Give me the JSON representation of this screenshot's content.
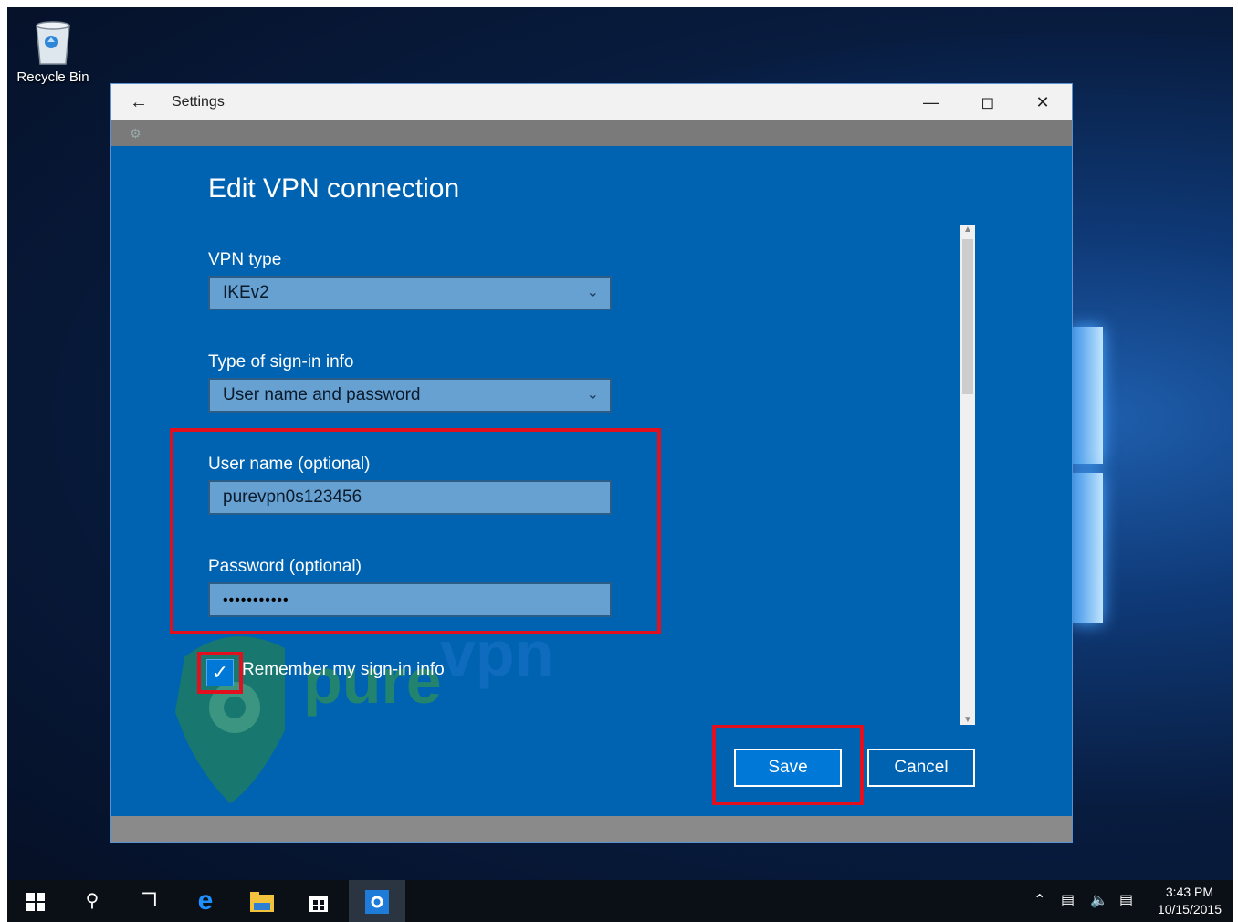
{
  "desktop": {
    "recycle_bin_label": "Recycle Bin"
  },
  "window": {
    "title": "Settings",
    "back_icon": "arrow-left-icon",
    "minimize_icon": "minimize-icon",
    "maximize_icon": "maximize-icon",
    "close_icon": "close-icon"
  },
  "dialog": {
    "heading": "Edit VPN connection",
    "vpn_type_label": "VPN type",
    "vpn_type_value": "IKEv2",
    "signin_type_label": "Type of sign-in info",
    "signin_type_value": "User name and password",
    "username_label": "User name (optional)",
    "username_value": "purevpn0s123456",
    "password_label": "Password (optional)",
    "password_value": "•••••••••••",
    "remember_label": "Remember my sign-in info",
    "remember_checked": true,
    "save_label": "Save",
    "cancel_label": "Cancel"
  },
  "watermark": {
    "brand": "purevpn"
  },
  "taskbar": {
    "icons": [
      "windows-start-icon",
      "search-icon",
      "task-view-icon",
      "edge-icon",
      "file-explorer-icon",
      "store-icon",
      "settings-icon"
    ],
    "time": "3:43 PM",
    "date": "10/15/2015"
  },
  "colors": {
    "dialog_bg": "#0063b1",
    "highlight": "#e2101e",
    "save_button": "#0078d7"
  }
}
